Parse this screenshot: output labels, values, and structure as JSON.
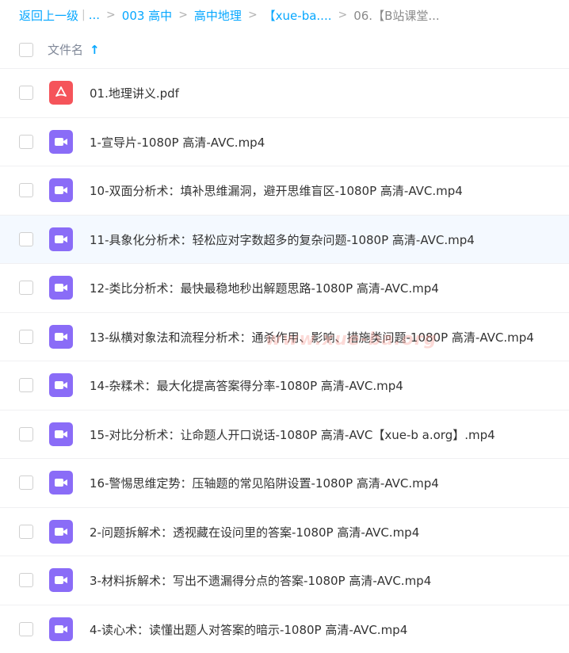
{
  "breadcrumb": {
    "back": "返回上一级",
    "ellipsis": "...",
    "items": [
      "003 高中",
      "高中地理",
      "【xue-ba....",
      "06.【B站课堂..."
    ]
  },
  "header": {
    "column": "文件名",
    "sort_icon": "arrow-up-icon"
  },
  "files": [
    {
      "name": "01.地理讲义.pdf",
      "type": "pdf"
    },
    {
      "name": "1-宣导片-1080P 高清-AVC.mp4",
      "type": "video"
    },
    {
      "name": "10-双面分析术：填补思维漏洞，避开思维盲区-1080P 高清-AVC.mp4",
      "type": "video"
    },
    {
      "name": "11-具象化分析术：轻松应对字数超多的复杂问题-1080P 高清-AVC.mp4",
      "type": "video",
      "hover": true
    },
    {
      "name": "12-类比分析术：最快最稳地秒出解题思路-1080P 高清-AVC.mp4",
      "type": "video"
    },
    {
      "name": "13-纵横对象法和流程分析术：通杀作用、影响、措施类问题-1080P 高清-AVC.mp4",
      "type": "video"
    },
    {
      "name": "14-杂糅术：最大化提高答案得分率-1080P 高清-AVC.mp4",
      "type": "video"
    },
    {
      "name": "15-对比分析术：让命题人开口说话-1080P 高清-AVC【xue-b a.org】.mp4",
      "type": "video"
    },
    {
      "name": "16-警惕思维定势：压轴题的常见陷阱设置-1080P 高清-AVC.mp4",
      "type": "video"
    },
    {
      "name": "2-问题拆解术：透视藏在设问里的答案-1080P 高清-AVC.mp4",
      "type": "video"
    },
    {
      "name": "3-材料拆解术：写出不遗漏得分点的答案-1080P 高清-AVC.mp4",
      "type": "video"
    },
    {
      "name": "4-读心术：读懂出题人对答案的暗示-1080P 高清-AVC.mp4",
      "type": "video"
    }
  ],
  "watermark": "www.xue-ba.org",
  "colors": {
    "accent": "#06a7ff",
    "pdf": "#f5545a",
    "video": "#8a6cf7"
  }
}
